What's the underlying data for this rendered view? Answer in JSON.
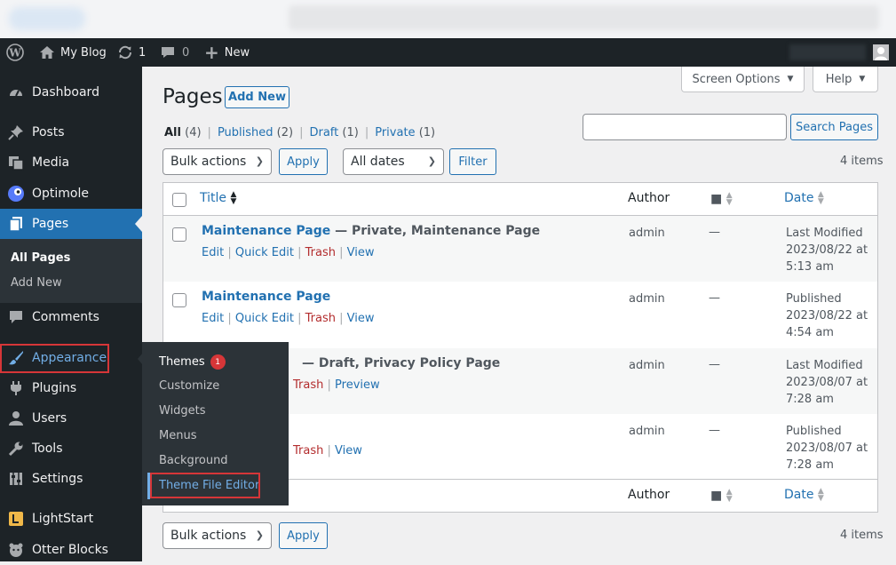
{
  "admin_bar": {
    "site_name": "My Blog",
    "updates_count": "1",
    "comments_count": "0",
    "new_label": "New"
  },
  "sidebar": {
    "items": [
      {
        "label": "Dashboard"
      },
      {
        "label": "Posts"
      },
      {
        "label": "Media"
      },
      {
        "label": "Optimole"
      },
      {
        "label": "Pages"
      },
      {
        "label": "Comments"
      },
      {
        "label": "Appearance"
      },
      {
        "label": "Plugins"
      },
      {
        "label": "Users"
      },
      {
        "label": "Tools"
      },
      {
        "label": "Settings"
      },
      {
        "label": "LightStart"
      },
      {
        "label": "Otter Blocks"
      }
    ],
    "pages_submenu": [
      {
        "label": "All Pages"
      },
      {
        "label": "Add New"
      }
    ]
  },
  "flyout": {
    "items": [
      {
        "label": "Themes"
      },
      {
        "label": "Customize"
      },
      {
        "label": "Widgets"
      },
      {
        "label": "Menus"
      },
      {
        "label": "Background"
      },
      {
        "label": "Theme File Editor"
      }
    ],
    "themes_badge": "1"
  },
  "page": {
    "title": "Pages",
    "add_new": "Add New",
    "screen_options": "Screen Options",
    "help": "Help",
    "search_button": "Search Pages",
    "search_value": ""
  },
  "filters": {
    "views": [
      {
        "label": "All",
        "count": "(4)"
      },
      {
        "label": "Published",
        "count": "(2)"
      },
      {
        "label": "Draft",
        "count": "(1)"
      },
      {
        "label": "Private",
        "count": "(1)"
      }
    ],
    "bulk_actions": "Bulk actions",
    "apply": "Apply",
    "dates": "All dates",
    "filter": "Filter",
    "items_count": "4 items"
  },
  "table": {
    "columns": {
      "title": "Title",
      "author": "Author",
      "date": "Date"
    },
    "rows": [
      {
        "title": "Maintenance Page",
        "state": " — Private, Maintenance Page",
        "actions": [
          "Edit",
          "Quick Edit",
          "Trash",
          "View"
        ],
        "author": "admin",
        "comments": "—",
        "date_status": "Last Modified",
        "date": "2023/08/22 at",
        "time": "5:13 am"
      },
      {
        "title": "Maintenance Page",
        "state": "",
        "actions": [
          "Edit",
          "Quick Edit",
          "Trash",
          "View"
        ],
        "author": "admin",
        "comments": "—",
        "date_status": "Published",
        "date": "2023/08/22 at",
        "time": "4:54 am"
      },
      {
        "title": "",
        "state": "— Draft, Privacy Policy Page",
        "actions": [
          "Trash",
          "Preview"
        ],
        "author": "admin",
        "comments": "—",
        "date_status": "Last Modified",
        "date": "2023/08/07 at",
        "time": "7:28 am"
      },
      {
        "title": "",
        "state": "",
        "actions": [
          "Trash",
          "View"
        ],
        "author": "admin",
        "comments": "—",
        "date_status": "Published",
        "date": "2023/08/07 at",
        "time": "7:28 am"
      }
    ]
  },
  "bottom": {
    "bulk_actions": "Bulk actions",
    "apply": "Apply",
    "items_count": "4 items"
  }
}
